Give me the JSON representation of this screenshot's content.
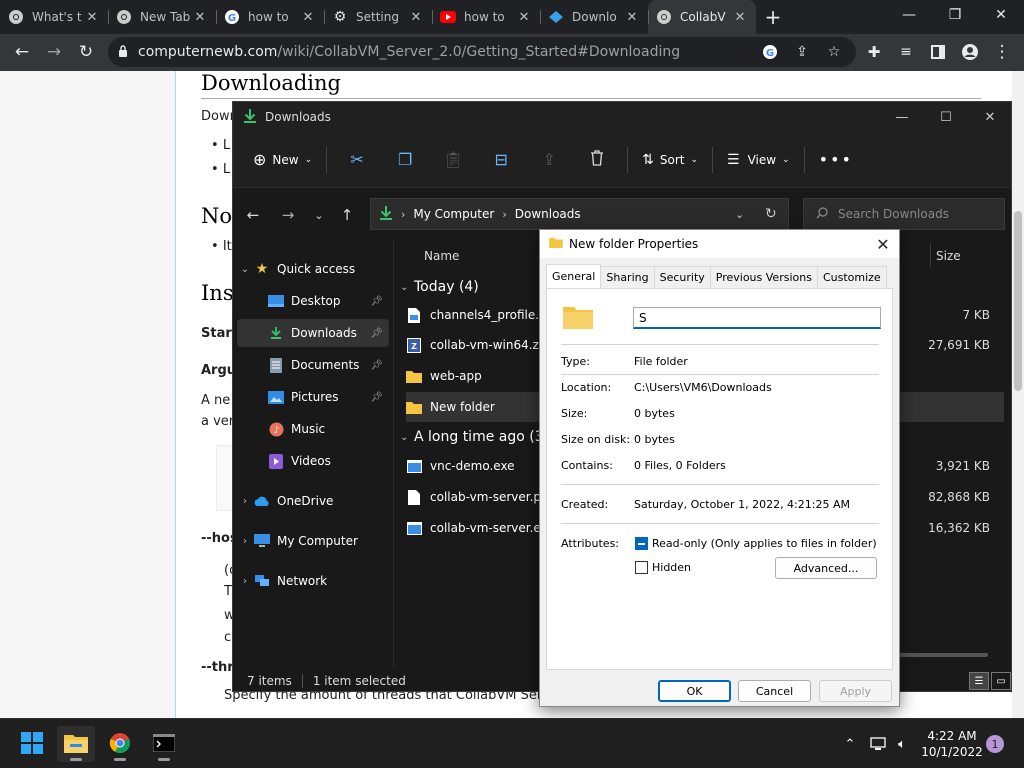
{
  "browser": {
    "tabs": [
      {
        "title": "What's t",
        "icon": "chrome-icon"
      },
      {
        "title": "New Tab",
        "icon": "chrome-icon"
      },
      {
        "title": "how to",
        "icon": "google-icon"
      },
      {
        "title": "Setting",
        "icon": "gear-icon"
      },
      {
        "title": "how to",
        "icon": "youtube-icon"
      },
      {
        "title": "Downlo",
        "icon": "collabvm-icon"
      },
      {
        "title": "CollabV",
        "icon": "chrome-icon"
      }
    ],
    "url_domain": "computernewb.com",
    "url_path": "/wiki/CollabVM_Server_2.0/Getting_Started#Downloading"
  },
  "webpage": {
    "heading_downloading": "Downloading",
    "para_down": "Down",
    "bullet_1": "L",
    "bullet_2": "L",
    "heading_notes": "Not",
    "bullet_3": "It",
    "heading_install": "Ins",
    "start": "Star",
    "args": "Argu",
    "anew": "A ne",
    "aver": "a ver",
    "host": "--hos",
    "c_paren": "(c",
    "t": "T",
    "w": "w",
    "c": "c",
    "threads": "--thre",
    "specify": "Specify the amount of threads that CollabVM Serve"
  },
  "explorer": {
    "title": "Downloads",
    "cmd": {
      "new": "New",
      "sort": "Sort",
      "view": "View"
    },
    "address": {
      "root": "My Computer",
      "current": "Downloads"
    },
    "search_placeholder": "Search Downloads",
    "nav": {
      "quick_access": "Quick access",
      "desktop": "Desktop",
      "downloads": "Downloads",
      "documents": "Documents",
      "pictures": "Pictures",
      "music": "Music",
      "videos": "Videos",
      "onedrive": "OneDrive",
      "my_computer": "My Computer",
      "network": "Network"
    },
    "columns": {
      "name": "Name",
      "size": "Size"
    },
    "groups": {
      "today": "Today (4)",
      "long_ago": "A long time ago (3"
    },
    "files": [
      {
        "name": "channels4_profile.jpg",
        "size": "7 KB"
      },
      {
        "name": "collab-vm-win64.zip",
        "size": "27,691 KB"
      },
      {
        "name": "web-app",
        "size": ""
      },
      {
        "name": "New folder",
        "size": ""
      },
      {
        "name": "vnc-demo.exe",
        "size": "3,921 KB"
      },
      {
        "name": "collab-vm-server.pdb",
        "size": "82,868 KB"
      },
      {
        "name": "collab-vm-server.exe",
        "size": "16,362 KB"
      }
    ],
    "status": {
      "items": "7 items",
      "selected": "1 item selected"
    }
  },
  "props": {
    "title": "New folder Properties",
    "tabs": [
      "General",
      "Sharing",
      "Security",
      "Previous Versions",
      "Customize"
    ],
    "name_value": "S",
    "labels": {
      "type": "Type:",
      "location": "Location:",
      "size": "Size:",
      "size_on_disk": "Size on disk:",
      "contains": "Contains:",
      "created": "Created:",
      "attributes": "Attributes:"
    },
    "values": {
      "type": "File folder",
      "location": "C:\\Users\\VM6\\Downloads",
      "size": "0 bytes",
      "size_on_disk": "0 bytes",
      "contains": "0 Files, 0 Folders",
      "created": "Saturday, October 1, 2022, 4:21:25 AM"
    },
    "readonly_label": "Read-only (Only applies to files in folder)",
    "hidden_label": "Hidden",
    "advanced": "Advanced...",
    "ok": "OK",
    "cancel": "Cancel",
    "apply": "Apply"
  },
  "taskbar": {
    "time": "4:22 AM",
    "date": "10/1/2022",
    "notifications": "1"
  },
  "colors": {
    "folder": "#f4c542",
    "accent": "#0067c0",
    "download_green": "#3cc36e"
  }
}
